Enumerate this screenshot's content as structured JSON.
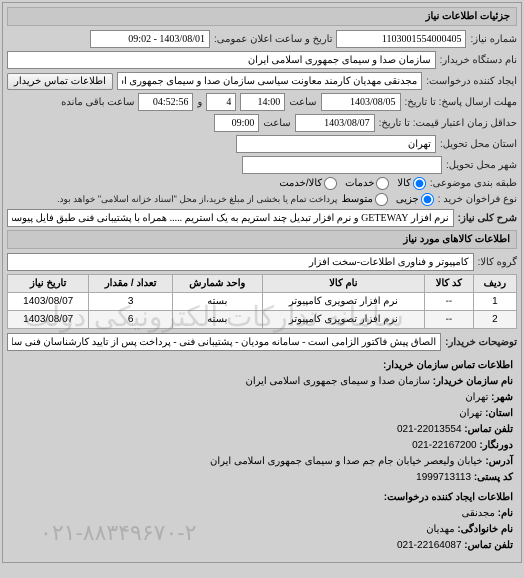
{
  "header": {
    "title": "جزئیات اطلاعات نیاز"
  },
  "fields": {
    "request_no_label": "شماره نیاز:",
    "request_no": "1103001554000405",
    "announce_label": "تاریخ و ساعت اعلان عمومی:",
    "announce_value": "1403/08/01 - 09:02",
    "buyer_org_label": "نام دستگاه خریدار:",
    "buyer_org": "سازمان صدا و سیمای جمهوری اسلامی ایران",
    "creator_label": "ایجاد کننده درخواست:",
    "creator": "مجدنقی مهدیان کارمند معاونت سیاسی سازمان صدا و سیمای جمهوری اسلامی",
    "contact_btn": "اطلاعات تماس خریدار",
    "start_deadline_label": "مهلت ارسال پاسخ: تا تاریخ:",
    "start_date": "1403/08/05",
    "time_label": "ساعت",
    "start_time": "14:00",
    "remain_days": "4",
    "remain_time": "04:52:56",
    "remain_suffix": "ساعت باقی مانده",
    "end_deadline_label": "حداقل زمان اعتبار قیمت: تا تاریخ:",
    "end_date": "1403/08/07",
    "end_time": "09:00",
    "province_label": "استان محل تحویل:",
    "province": "تهران",
    "city_label": "شهر محل تحویل:",
    "city": "",
    "category_label": "طبقه بندی موضوعی:",
    "cat_kala": "کالا",
    "cat_khadamat": "خدمات",
    "both_label": "کالا/خدمت",
    "price_type_label": "نوع فراخوان خرید :",
    "pt_partial": "جزیی",
    "pt_medium": "متوسط",
    "pt_note": "پرداخت تمام یا بخشی از مبلغ خرید،از محل \"اسناد خزانه اسلامی\" خواهد بود.",
    "key_label": "شرح کلی نیاز:",
    "key_value": "نرم افزار GETEWAY و نرم افزار تبدیل چند استریم به یک استریم ..... همراه با پشتیبانی فنی طبق فایل پیوست",
    "goods_section": "اطلاعات کالاهای مورد نیاز",
    "group_label": "گروه کالا:",
    "group_value": "کامپیوتر و فناوری اطلاعات-سخت افزار",
    "desc_label": "توضیحات خریدار:",
    "desc_value": "الصاق پیش فاکتور الزامی است - سامانه مودیان - پشتیبانی فنی - پرداخت پس از تایید کارشناسان فنی سازمان"
  },
  "table": {
    "headers": {
      "row": "ردیف",
      "code": "کد کالا",
      "name": "نام کالا",
      "unit": "واحد شمارش",
      "qty": "تعداد / مقدار",
      "date": "تاریخ نیاز"
    },
    "rows": [
      {
        "row": "1",
        "code": "--",
        "name": "نرم افزار تصویری کامپیوتر",
        "unit": "بسته",
        "qty": "3",
        "date": "1403/08/07"
      },
      {
        "row": "2",
        "code": "--",
        "name": "نرم افزار تصویری کامپیوتر",
        "unit": "بسته",
        "qty": "6",
        "date": "1403/08/07"
      }
    ]
  },
  "contact": {
    "section_title": "اطلاعات تماس سازمان خریدار:",
    "org_label": "نام سازمان خریدار:",
    "org": "سازمان صدا و سیمای جمهوری اسلامی ایران",
    "city_label": "شهر:",
    "city": "تهران",
    "province_label": "استان:",
    "province": "تهران",
    "tel_label": "تلفن تماس:",
    "tel": "22013554-021",
    "fax_label": "دورنگار:",
    "fax": "22167200-021",
    "postal_label": "کد پستی:",
    "postal": "1999713113",
    "address_label": "آدرس:",
    "address": "خیابان ولیعصر خیابان جام جم صدا و سیمای جمهوری اسلامی ایران",
    "creator_section": "اطلاعات ایجاد کننده درخواست:",
    "name_label": "نام:",
    "name": "مجدنقی",
    "family_label": "نام خانوادگی:",
    "family": "مهدیان",
    "ctel_label": "تلفن تماس:",
    "ctel": "22164087-021"
  },
  "watermark": "سامانه تدارکات الکترونیکی دولت",
  "bottom_number": "۰۲۱-۸۸۳۴۹۶۷۰-۲"
}
